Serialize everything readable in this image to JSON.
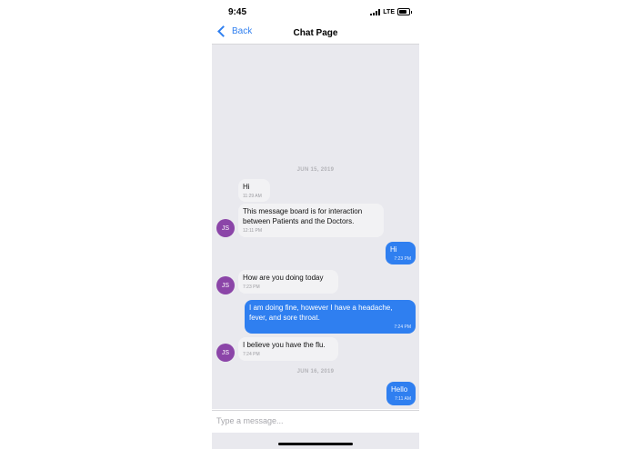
{
  "status_bar": {
    "time": "9:45",
    "network": "LTE"
  },
  "nav": {
    "back_label": "Back",
    "title": "Chat Page"
  },
  "dates": [
    "JUN 15, 2019",
    "JUN 16, 2019"
  ],
  "messages": [
    {
      "direction": "incoming",
      "text": "Hi",
      "time": "11:29 AM",
      "avatar": ""
    },
    {
      "direction": "incoming",
      "text": "This message board is for interaction between Patients and the Doctors.",
      "time": "12:11 PM",
      "avatar": "JS"
    },
    {
      "direction": "outgoing",
      "text": "Hi",
      "time": "7:23 PM"
    },
    {
      "direction": "incoming",
      "text": "How are you doing today",
      "time": "7:23 PM",
      "avatar": "JS"
    },
    {
      "direction": "outgoing",
      "text": "I am doing fine, however I have a headache, fever, and sore throat.",
      "time": "7:24 PM"
    },
    {
      "direction": "incoming",
      "text": "I believe you have the flu.",
      "time": "7:24 PM",
      "avatar": "JS"
    },
    {
      "direction": "outgoing",
      "text": "Hello",
      "time": "7:11 AM"
    }
  ],
  "composer": {
    "placeholder": "Type a message..."
  },
  "colors": {
    "outgoing_bubble": "#2f7ff0",
    "incoming_bubble": "#f2f2f4",
    "avatar": "#8b45a8",
    "chat_background": "#e9e9ee",
    "accent": "#2f7ff0"
  }
}
